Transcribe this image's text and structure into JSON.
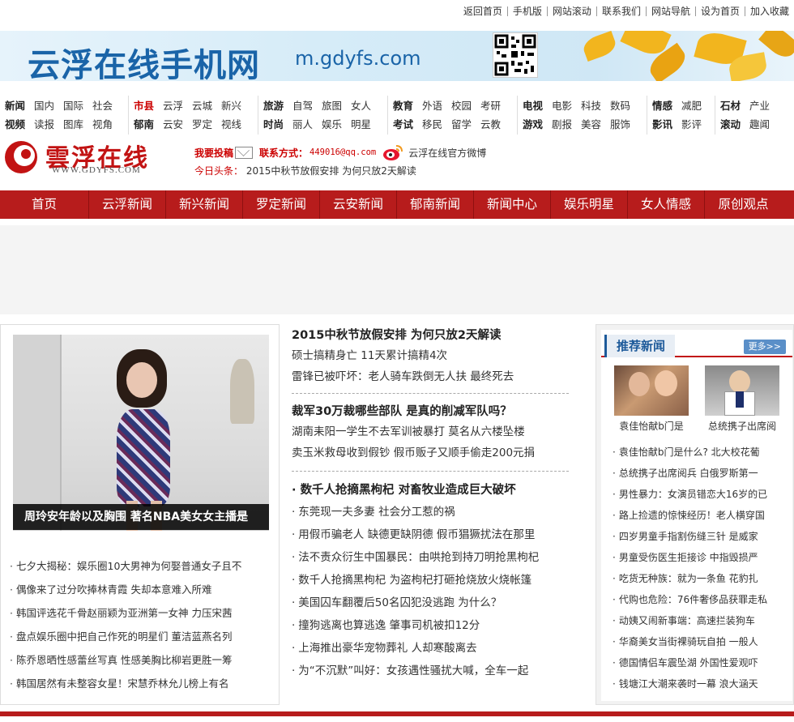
{
  "top_links": [
    "返回首页",
    "手机版",
    "网站滚动",
    "联系我们",
    "网站导航",
    "设为首页",
    "加入收藏"
  ],
  "banner": {
    "title": "云浮在线手机网",
    "url_text": "m.gdyfs.com"
  },
  "category_groups": [
    {
      "row1": [
        "新闻",
        "国内",
        "国际",
        "社会"
      ],
      "row2": [
        "视频",
        "读报",
        "图库",
        "视角"
      ]
    },
    {
      "row1": [
        "市县",
        "云浮",
        "云城",
        "新兴"
      ],
      "row2": [
        "郁南",
        "云安",
        "罗定",
        "视线"
      ]
    },
    {
      "row1": [
        "旅游",
        "自驾",
        "旅图",
        "女人"
      ],
      "row2": [
        "时尚",
        "丽人",
        "娱乐",
        "明星"
      ]
    },
    {
      "row1": [
        "教育",
        "外语",
        "校园",
        "考研"
      ],
      "row2": [
        "考试",
        "移民",
        "留学",
        "云教"
      ]
    },
    {
      "row1": [
        "电视",
        "电影",
        "科技",
        "数码"
      ],
      "row2": [
        "游戏",
        "剧报",
        "美容",
        "服饰"
      ]
    },
    {
      "row1": [
        "情感",
        "减肥"
      ],
      "row2": [
        "影讯",
        "影评"
      ]
    },
    {
      "row1": [
        "石材",
        "产业"
      ],
      "row2": [
        "滚动",
        "趣闻"
      ]
    }
  ],
  "logo": {
    "name": "雲浮在线",
    "domain": "WWW.GDYFS.COM"
  },
  "contact": {
    "submit_label": "我要投稿",
    "contact_label": "联系方式：",
    "email": "449016@qq.com",
    "weibo_label": "云浮在线官方微博"
  },
  "headline": {
    "label": "今日头条：",
    "text": "2015中秋节放假安排 为何只放2天解读"
  },
  "main_nav": [
    "首页",
    "云浮新闻",
    "新兴新闻",
    "罗定新闻",
    "云安新闻",
    "郁南新闻",
    "新闻中心",
    "娱乐明星",
    "女人情感",
    "原创观点"
  ],
  "feature": {
    "caption": "周玲安年龄以及胸围 著名NBA美女女主播是"
  },
  "left_list": [
    "七夕大揭秘：娱乐圈10大男神为何娶普通女子且不",
    "偶像来了过分吹捧林青霞 失却本意难入所难",
    "韩国评选花千骨赵丽颖为亚洲第一女神 力压宋茜",
    "盘点娱乐圈中把自己作死的明星们 董洁蓝燕名列",
    "陈乔恩晒性感蕾丝写真 性感美胸比柳岩更胜一筹",
    "韩国居然有未整容女星！宋慧乔林允儿榜上有名"
  ],
  "middle": {
    "block1": {
      "title": "2015中秋节放假安排 为何只放2天解读",
      "subs": [
        "硕士搞精身亡 11天累计搞精4次",
        "雷锋已被吓坏：老人骑车跌倒无人扶 最终死去"
      ]
    },
    "block2": {
      "title": "裁军30万裁哪些部队 是真的削减军队吗？",
      "subs": [
        "湖南耒阳一学生不去军训被暴打 莫名从六楼坠楼",
        "卖玉米救母收到假钞 假币贩子又顺手偷走200元捐"
      ]
    },
    "block3_title": "数千人抢摘黑枸杞 对畜牧业造成巨大破坏",
    "list": [
      "东莞现一夫多妻 社会分工惹的祸",
      "用假币骗老人 缺德更缺阴德 假币猖獗扰法在那里",
      "法不责众衍生中国暴民：由哄抢到持刀明抢黑枸杞",
      "数千人抢摘黑枸杞 为盗枸杞打砸抢烧放火烧帐篷",
      "美国囚车翻覆后50名囚犯没逃跑 为什么？",
      "撞狗逃离也算逃逸 肇事司机被扣12分",
      "上海推出豪华宠物葬礼 人却寒酸离去",
      "为“不沉默”叫好：女孩遇性骚扰大喊，全车一起"
    ]
  },
  "right": {
    "title": "推荐新闻",
    "more": "更多>>",
    "thumb_captions": [
      "袁佳怡献b门是",
      "总统携子出席阅"
    ],
    "list": [
      "袁佳怡献b门是什么? 北大校花葡",
      "总统携子出席阅兵 白俄罗斯第一",
      "男性暴力：女演员错恋大16岁的已",
      "路上捡遗的惊悚经历！老人横穿国",
      "四岁男童手指割伤缝三针 是威家",
      "男童受伤医生拒接诊 中指毁损严",
      "吃货无种族：就为一条鱼 花豹扎",
      "代购也危险：76件奢侈品获罪走私",
      "动姨又闹新事端：高速拦装狗车",
      "华裔美女当街裸骑玩自拍 一般人",
      "德国情侣车震坠湖 外国性爱观吓",
      "钱塘江大潮来袭时一幕 浪大涵天"
    ]
  },
  "colors": {
    "nav_red": "#b71c1c",
    "accent_blue": "#1d5a9a",
    "brand_red": "#c21313"
  }
}
